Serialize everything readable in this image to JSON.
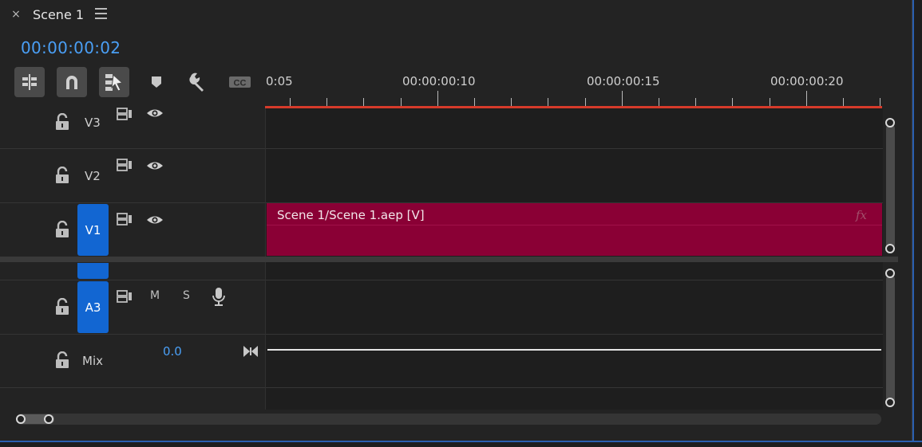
{
  "panel": {
    "close_glyph": "×",
    "title": "Scene 1",
    "timecode": "00:00:00:02"
  },
  "toolbar": {
    "tools": [
      "insert-sequence-icon",
      "snap-magnet-icon",
      "linked-selection-icon",
      "add-marker-icon",
      "wrench-settings-icon",
      "closed-captions-icon"
    ],
    "cc_label": "CC"
  },
  "ruler": {
    "labels": [
      "0:05",
      "00:00:00:10",
      "00:00:00:15",
      "00:00:00:20"
    ],
    "playhead_color": "#d63a2a"
  },
  "tracks": {
    "video": [
      {
        "name": "V3",
        "targeted": false
      },
      {
        "name": "V2",
        "targeted": false
      },
      {
        "name": "V1",
        "targeted": true
      }
    ],
    "audio": [
      {
        "name": "A3",
        "targeted": true,
        "mute": "M",
        "solo": "S"
      }
    ],
    "mix": {
      "name": "Mix",
      "value": "0.0"
    }
  },
  "clip": {
    "name": "Scene 1/Scene 1.aep [V]",
    "fx": "fx",
    "color": "#8a0035"
  },
  "colors": {
    "accent": "#4a9ff5",
    "target": "#1266d2"
  }
}
